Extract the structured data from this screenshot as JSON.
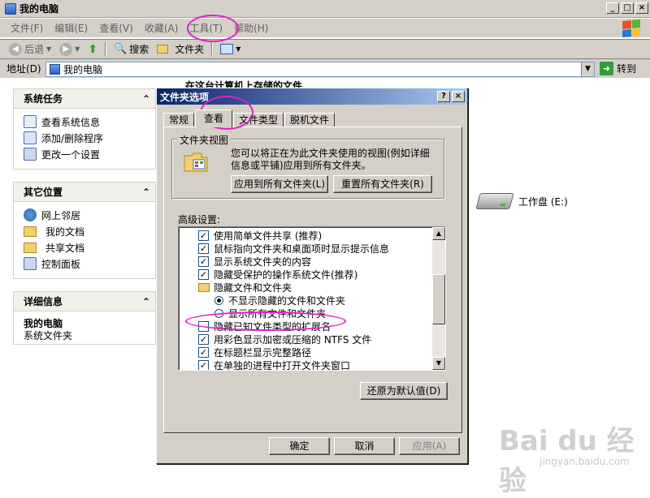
{
  "window": {
    "title": "我的电脑"
  },
  "menubar": {
    "items": [
      "文件(F)",
      "编辑(E)",
      "查看(V)",
      "收藏(A)",
      "工具(T)",
      "帮助(H)"
    ]
  },
  "toolbar": {
    "back": "后退",
    "search": "搜索",
    "folders": "文件夹"
  },
  "address": {
    "label": "地址(D)",
    "value": "我的电脑",
    "go": "转到"
  },
  "content": {
    "header": "在这台计算机上存储的文件",
    "drive_label": "工作盘 (E:)"
  },
  "sidebar": {
    "panels": [
      {
        "title": "系统任务",
        "items": [
          "查看系统信息",
          "添加/删除程序",
          "更改一个设置"
        ]
      },
      {
        "title": "其它位置",
        "items": [
          "网上邻居",
          "我的文档",
          "共享文档",
          "控制面板"
        ]
      },
      {
        "title": "详细信息",
        "name": "我的电脑",
        "desc": "系统文件夹"
      }
    ]
  },
  "dialog": {
    "title": "文件夹选项",
    "help": "?",
    "close": "×",
    "tabs": [
      "常规",
      "查看",
      "文件类型",
      "脱机文件"
    ],
    "folder_view": {
      "legend": "文件夹视图",
      "text": "您可以将正在为此文件夹使用的视图(例如详细信息或平铺)应用到所有文件夹。",
      "apply_all": "应用到所有文件夹(L)",
      "reset_all": "重置所有文件夹(R)"
    },
    "advanced_label": "高级设置:",
    "settings": [
      {
        "type": "check",
        "checked": true,
        "label": "使用简单文件共享 (推荐)",
        "indent": 0
      },
      {
        "type": "check",
        "checked": true,
        "label": "鼠标指向文件夹和桌面项时显示提示信息",
        "indent": 0
      },
      {
        "type": "check",
        "checked": true,
        "label": "显示系统文件夹的内容",
        "indent": 0
      },
      {
        "type": "check",
        "checked": true,
        "label": "隐藏受保护的操作系统文件(推荐)",
        "indent": 0
      },
      {
        "type": "folder",
        "label": "隐藏文件和文件夹",
        "indent": 0
      },
      {
        "type": "radio",
        "checked": true,
        "label": "不显示隐藏的文件和文件夹",
        "indent": 1
      },
      {
        "type": "radio",
        "checked": false,
        "label": "显示所有文件和文件夹",
        "indent": 1
      },
      {
        "type": "check",
        "checked": false,
        "label": "隐藏已知文件类型的扩展名",
        "indent": 0
      },
      {
        "type": "check",
        "checked": true,
        "label": "用彩色显示加密或压缩的 NTFS 文件",
        "indent": 0
      },
      {
        "type": "check",
        "checked": true,
        "label": "在标题栏显示完整路径",
        "indent": 0
      },
      {
        "type": "check",
        "checked": true,
        "label": "在单独的进程中打开文件夹窗口",
        "indent": 0
      }
    ],
    "restore_defaults": "还原为默认值(D)",
    "ok": "确定",
    "cancel": "取消",
    "apply": "应用(A)"
  },
  "watermark": {
    "brand": "Bai du 经验",
    "url": "jingyan.baidu.com"
  },
  "colors": {
    "highlight": "#e020c8",
    "title_blue": "#0a246a"
  }
}
